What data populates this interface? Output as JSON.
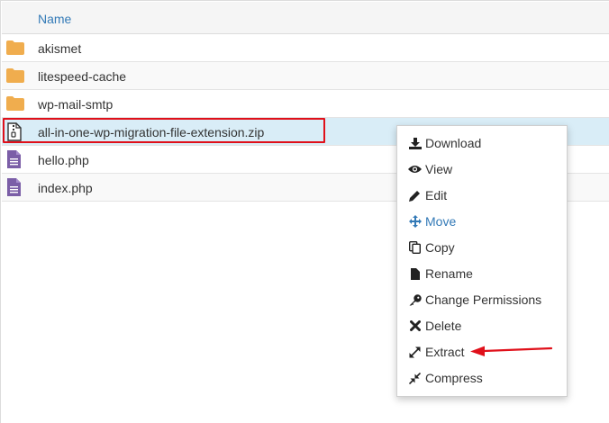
{
  "header": {
    "name_column": "Name"
  },
  "files": [
    {
      "name": "akismet",
      "type": "folder"
    },
    {
      "name": "litespeed-cache",
      "type": "folder"
    },
    {
      "name": "wp-mail-smtp",
      "type": "folder"
    },
    {
      "name": "all-in-one-wp-migration-file-extension.zip",
      "type": "zip",
      "selected": true
    },
    {
      "name": "hello.php",
      "type": "php"
    },
    {
      "name": "index.php",
      "type": "php"
    }
  ],
  "context_menu": {
    "items": [
      {
        "label": "Download",
        "icon": "download-icon"
      },
      {
        "label": "View",
        "icon": "eye-icon"
      },
      {
        "label": "Edit",
        "icon": "pencil-icon"
      },
      {
        "label": "Move",
        "icon": "move-icon"
      },
      {
        "label": "Copy",
        "icon": "copy-icon"
      },
      {
        "label": "Rename",
        "icon": "file-icon"
      },
      {
        "label": "Change Permissions",
        "icon": "key-icon"
      },
      {
        "label": "Delete",
        "icon": "x-icon"
      },
      {
        "label": "Extract",
        "icon": "expand-icon"
      },
      {
        "label": "Compress",
        "icon": "compress-icon"
      }
    ]
  },
  "colors": {
    "link": "#337ab7",
    "selected_row": "#d9edf7",
    "folder": "#f0ad4e",
    "php_icon": "#7b5ea7",
    "annotation": "#e0101a"
  }
}
